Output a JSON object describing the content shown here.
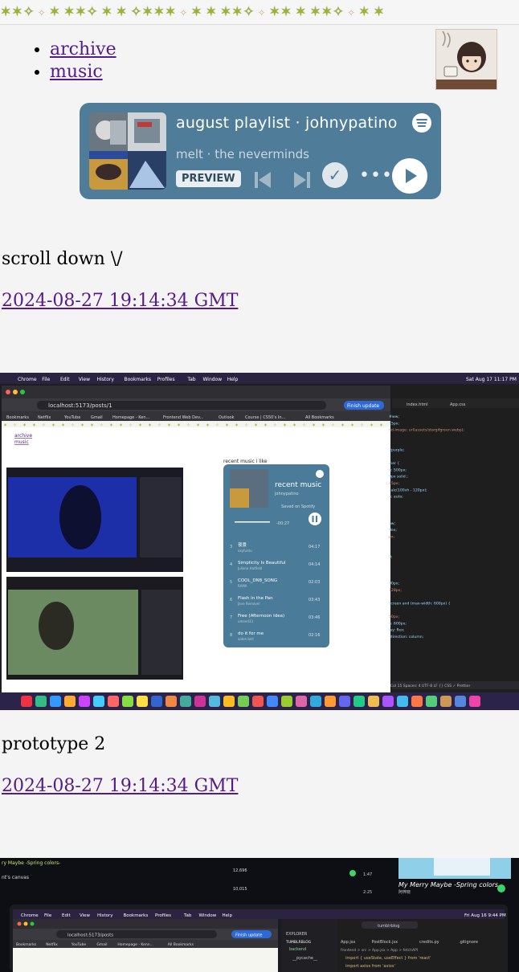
{
  "nav": {
    "items": [
      {
        "label": "archive"
      },
      {
        "label": "music"
      }
    ]
  },
  "player": {
    "title": "august playlist · johnypatino",
    "track": "melt · the neverminds",
    "preview_label": "PREVIEW"
  },
  "posts": [
    {
      "caption": "scroll down \\/",
      "date": "2024-08-27 19:14:34 GMT"
    },
    {
      "caption": "prototype 2",
      "date": "2024-08-27 19:14:34 GMT"
    }
  ],
  "screenshot1": {
    "menubar": [
      "Chrome",
      "File",
      "Edit",
      "View",
      "History",
      "Bookmarks",
      "Profiles",
      "Tab",
      "Window",
      "Help"
    ],
    "clock": "Sat Aug 17 11:17 PM",
    "url": "localhost:5173/posts/1",
    "finish_update": "Finish update",
    "bookmarks": [
      "Bookmarks",
      "Netflix",
      "YouTube",
      "Gmail",
      "Homepage - Ken...",
      "Frontend Web Dev...",
      "Outlook",
      "Course | CS50's In...",
      "All Bookmarks"
    ],
    "inner_nav": [
      "archive",
      "music"
    ],
    "recent_label": "recent music i like",
    "widget_title": "recent music",
    "widget_user": "johnypatino",
    "widget_saved": "Saved on Spotify",
    "widget_time": "-00:27",
    "tracks": [
      {
        "n": "3",
        "name": "夜景",
        "artist": "oxyfuntu",
        "time": "04:17"
      },
      {
        "n": "4",
        "name": "Simplicity Is Beautiful",
        "artist": "Juliana Hatfield",
        "time": "04:14"
      },
      {
        "n": "5",
        "name": "COOL_DN8_SONG",
        "artist": "RAMA",
        "time": "02:03"
      },
      {
        "n": "6",
        "name": "Flash in the Pan",
        "artist": "Jane Remover",
        "time": "03:43"
      },
      {
        "n": "7",
        "name": "Free (Afternoon Idea)",
        "artist": "umeed33",
        "time": "03:46"
      },
      {
        "n": "8",
        "name": "do it for me",
        "artist": "aiden bell",
        "time": "02:16"
      }
    ],
    "editor_tabs": [
      "index.html",
      "App.css"
    ],
    "code_lines": [
      "#ww;",
      "15px;",
      "nd-image: url(assets/stargifgreen.webp);",
      "",
      "",
      "2purple;",
      "",
      "iner {",
      "h: 500px;",
      "9px solid ;",
      "15px;",
      "calc(100vh - 120px);",
      "n: auto;",
      "",
      "",
      "",
      "ow;",
      "flex;",
      "px;",
      "",
      "",
      "0;",
      "",
      "",
      "",
      "00px;",
      "128px;",
      "",
      "screen and (max-width: 600px) {",
      "  {",
      "  50px;",
      "h: 600px;",
      "lay: flex;",
      "-direction: column;"
    ],
    "status": "Col 15   Spaces: 4   UTF-8   LF   {} CSS   ✓ Prettier"
  },
  "screenshot2": {
    "top_left": "ry Maybe -Spring colors-",
    "label2": "nt's canvas",
    "num1": "12,696",
    "num2": "10,015",
    "t1": "1:47",
    "t2": "2:25",
    "right_title": "My Merry Maybe -Spring colors",
    "right_sub": "阿梓晓",
    "menubar": [
      "Chrome",
      "File",
      "Edit",
      "View",
      "History",
      "Bookmarks",
      "Profiles",
      "Tab",
      "Window",
      "Help"
    ],
    "clock": "Fri Aug 16  9:44 PM",
    "url": "localhost:5173/posts",
    "finish_update": "Finish update",
    "bookmarks": [
      "Bookmarks",
      "Netflix",
      "YouTube",
      "Gmail",
      "Homepage - Kenn...",
      "All Bookmarks"
    ],
    "explorer": "EXPLORER",
    "project": "TUMBLRBLOG",
    "folder1": "backend",
    "folder2": "__pycache__",
    "tabs": [
      "App.jsx",
      "PostBlock.jsx",
      "credits.py",
      ".gitignore"
    ],
    "breadcrumb": "frontend > src > App.jsx > App > fetchAPI",
    "code1": "import { useState, useEffect } from 'react'",
    "code2": "import axios from 'axios'",
    "search": "tumblrblog"
  },
  "colors": {
    "player_bg": "#4f7d99",
    "link": "#551a8b",
    "star": "#9bb629"
  }
}
